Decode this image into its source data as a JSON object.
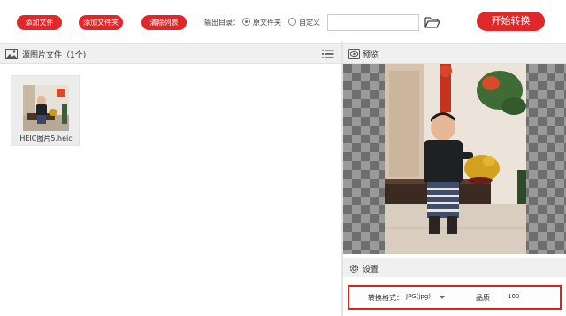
{
  "toolbar": {
    "add_file": "添加文件",
    "add_folder": "添加文件夹",
    "clear_list": "清除列表",
    "output_dir_label": "输出目录：",
    "option_source": "原文件夹",
    "option_custom": "自定义",
    "output_path_value": "",
    "start_button": "开始转换",
    "selected_option": "原文件夹"
  },
  "file_panel": {
    "title": "源图片文件（1个)",
    "files": [
      {
        "name": "HEIC图片5.heic"
      }
    ]
  },
  "preview_panel": {
    "title": "预览"
  },
  "settings_panel": {
    "title": "设置",
    "format_label": "转换格式：",
    "format_value": "JPG(jpg)",
    "quality_label": "品质",
    "quality_value": "100"
  },
  "colors": {
    "accent": "#e0282a",
    "highlight_box": "#d8231f",
    "panel_header": "#f0f0f0"
  },
  "icons": [
    "image-icon",
    "list-menu-icon",
    "folder-open-icon",
    "eye-icon",
    "gear-icon",
    "dropdown-arrow-icon"
  ]
}
